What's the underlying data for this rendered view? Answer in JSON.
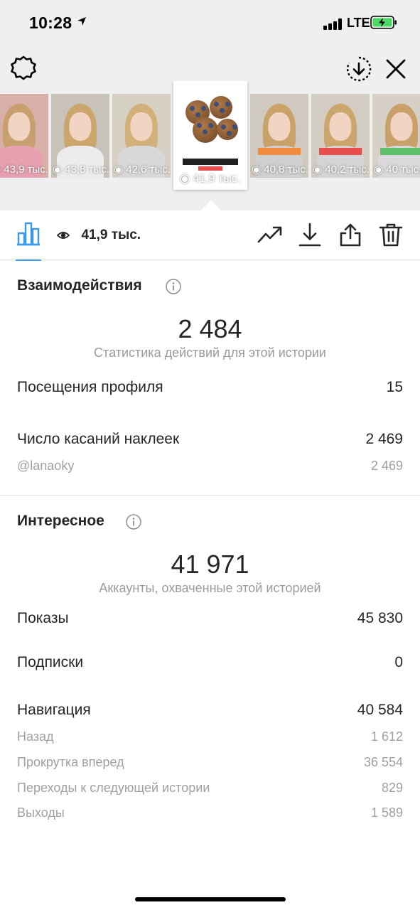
{
  "status_bar": {
    "time": "10:28",
    "network": "LTE"
  },
  "story_strip": {
    "thumbnails": [
      {
        "views": "43,9 тыс.",
        "bg": "#d9b0a8",
        "hair": "#c8a070",
        "body": "#e7a0b0"
      },
      {
        "views": "43,8 тыс.",
        "bg": "#c9c2b8",
        "hair": "#caa56c",
        "body": "#ececec"
      },
      {
        "views": "42,6 тыс.",
        "bg": "#d6cfc4",
        "hair": "#d2b07a",
        "body": "#d8d8d8"
      },
      {
        "views": "41,9 тыс.",
        "selected": true
      },
      {
        "views": "40,8 тыс.",
        "bg": "#cfc9c0",
        "hair": "#c9a26a",
        "body": "#cfcfcf",
        "sticker": "#f08a3c"
      },
      {
        "views": "40,2 тыс.",
        "bg": "#d3ccc2",
        "hair": "#caa56c",
        "body": "#d4d4d4",
        "sticker": "#e94e4e"
      },
      {
        "views": "40 тыс.",
        "bg": "#d7d0c6",
        "hair": "#c7a06a",
        "body": "#d9d9d9",
        "sticker": "#5fbf6a"
      }
    ]
  },
  "summary": {
    "reach_value": "41,9 тыс."
  },
  "interactions": {
    "title": "Взаимодействия",
    "total": "2 484",
    "total_caption": "Статистика действий для этой истории",
    "rows": [
      {
        "label": "Посещения профиля",
        "value": "15"
      },
      {
        "label": "Число касаний наклеек",
        "value": "2 469"
      },
      {
        "label": "@lanaoky",
        "value": "2 469"
      }
    ]
  },
  "discovery": {
    "title": "Интересное",
    "total": "41 971",
    "total_caption": "Аккаунты, охваченные этой историей",
    "rows": [
      {
        "label": "Показы",
        "value": "45 830"
      },
      {
        "label": "Подписки",
        "value": "0"
      },
      {
        "label": "Навигация",
        "value": "40 584"
      },
      {
        "label": "Назад",
        "value": "1 612"
      },
      {
        "label": "Прокрутка вперед",
        "value": "36 554"
      },
      {
        "label": "Переходы к следующей истории",
        "value": "829"
      },
      {
        "label": "Выходы",
        "value": "1 589"
      }
    ]
  },
  "colors": {
    "accent": "#3897f0",
    "battery": "#4cd964",
    "muted_text": "#a0a0a0"
  }
}
